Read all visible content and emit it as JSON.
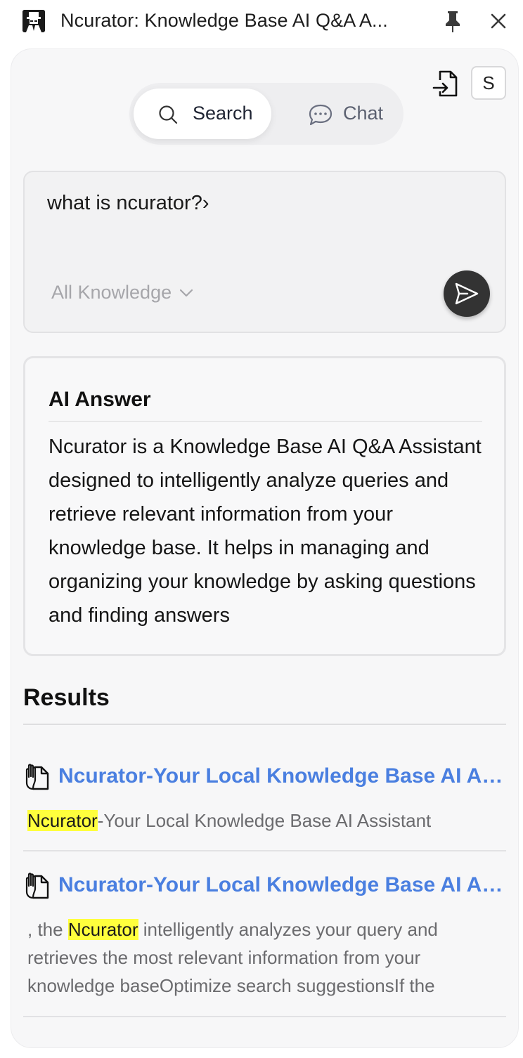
{
  "window": {
    "title": "Ncurator: Knowledge Base AI Q&A A...",
    "logo_icon": "agent-spy-icon",
    "pin_icon": "pin-icon",
    "close_icon": "close-icon"
  },
  "header": {
    "import_icon": "file-import-icon",
    "avatar_label": "S"
  },
  "mode_tabs": [
    {
      "label": "Search",
      "icon": "search-icon",
      "active": true
    },
    {
      "label": "Chat",
      "icon": "chat-bubble-icon",
      "active": false
    }
  ],
  "query": {
    "value": "what is ncurator?›",
    "scope_label": "All Knowledge",
    "send_icon": "send-icon"
  },
  "ai_answer": {
    "title": "AI Answer",
    "body": "Ncurator is a Knowledge Base AI Q&A Assistant designed to intelligently analyze queries and retrieve relevant information from your knowledge base. It helps in managing and organizing your knowledge by asking questions and finding answers"
  },
  "results": {
    "title": "Results",
    "items": [
      {
        "title": "Ncurator-Your Local Knowledge Base AI Assistant",
        "snippet_before": "",
        "snippet_highlight": "Ncurator",
        "snippet_after": "-Your Local Knowledge Base AI Assistant"
      },
      {
        "title": "Ncurator-Your Local Knowledge Base AI Assistant",
        "snippet_before": ", the ",
        "snippet_highlight": "Ncurator",
        "snippet_after": " intelligently analyzes your query and retrieves the most relevant information from your knowledge baseOptimize search suggestionsIf the"
      }
    ]
  },
  "colors": {
    "accent_link": "#4a7fe0",
    "highlight": "#ffff3d",
    "send_button": "#333333"
  }
}
